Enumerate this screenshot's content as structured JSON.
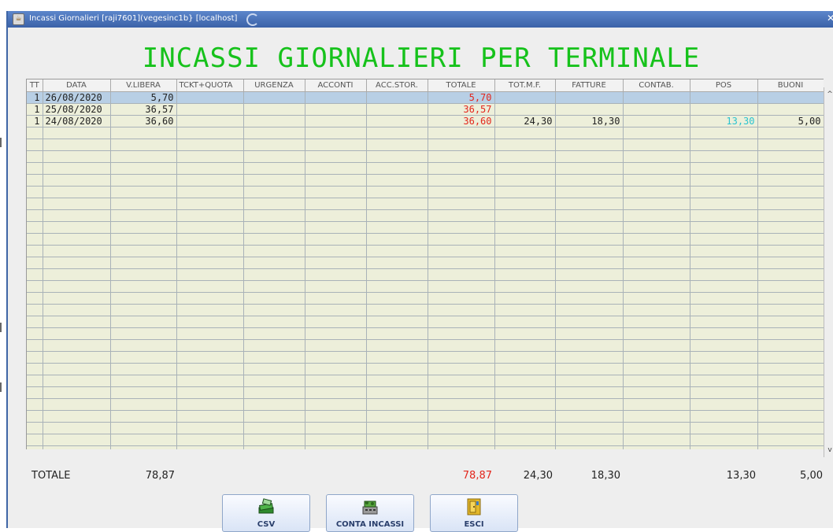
{
  "window": {
    "title": "Incassi Giornalieri [raji7601](vegesinc1b} [localhost]"
  },
  "heading": "INCASSI GIORNALIERI PER TERMINALE",
  "table": {
    "columns": [
      "TT",
      "DATA",
      "V.LIBERA",
      "TCKT+QUOTA",
      "URGENZA",
      "ACCONTI",
      "ACC.STOR.",
      "TOTALE",
      "TOT.M.F.",
      "FATTURE",
      "CONTAB.",
      "POS",
      "BUONI"
    ],
    "rows": [
      [
        "1",
        "26/08/2020",
        "5,70",
        "",
        "",
        "",
        "",
        "5,70",
        "",
        "",
        "",
        "",
        ""
      ],
      [
        "1",
        "25/08/2020",
        "36,57",
        "",
        "",
        "",
        "",
        "36,57",
        "",
        "",
        "",
        "",
        ""
      ],
      [
        "1",
        "24/08/2020",
        "36,60",
        "",
        "",
        "",
        "",
        "36,60",
        "24,30",
        "18,30",
        "",
        "13,30",
        "5,00"
      ]
    ],
    "empty_rows": 28,
    "selected_row": 0
  },
  "scrollbar": {
    "up": "^",
    "down": "v"
  },
  "totals": {
    "label": "TOTALE",
    "v_libera": "78,87",
    "totale": "78,87",
    "tot_mf": "24,30",
    "fatture": "18,30",
    "pos": "13,30",
    "buoni": "5,00"
  },
  "buttons": {
    "csv": "CSV",
    "conta_incassi": "CONTA INCASSI",
    "esci": "ESCI"
  },
  "colors": {
    "heading": "#16c21b",
    "totale_red": "#e3261c",
    "pos_cyan": "#2ac3d0",
    "grid_bg": "#edefda",
    "selected_row": "#b8cfe5"
  },
  "icons": {
    "app": "java-cup-icon",
    "csv": "money-stack-icon",
    "conta_incassi": "cash-counter-icon",
    "esci": "exit-door-icon"
  }
}
